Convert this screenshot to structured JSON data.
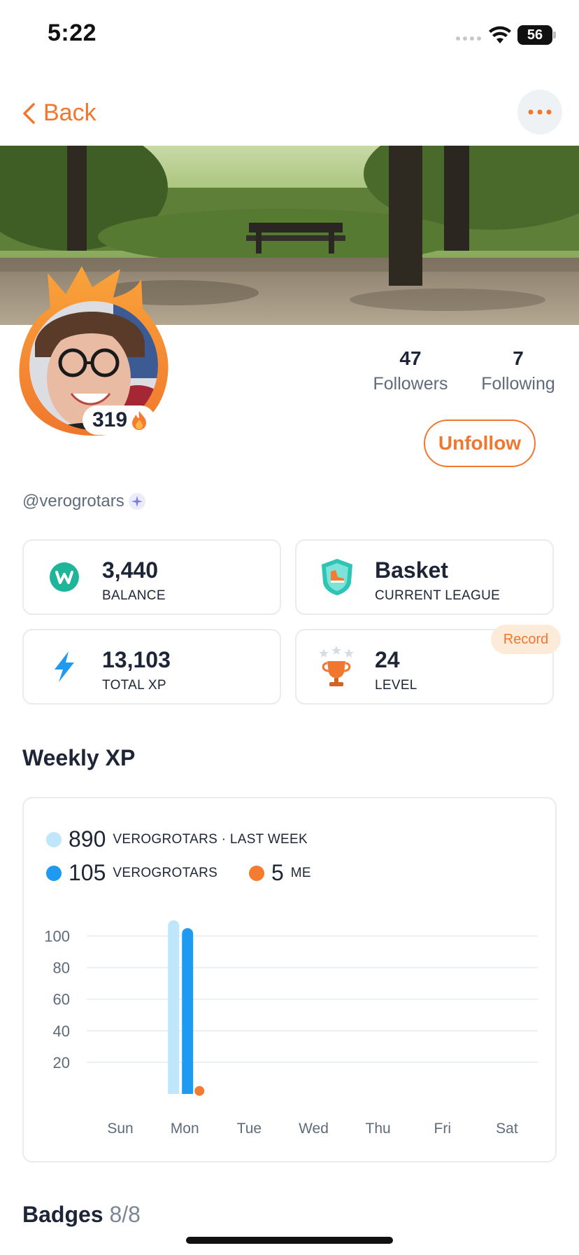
{
  "status": {
    "time": "5:22",
    "battery": "56"
  },
  "header": {
    "back_label": "Back"
  },
  "profile": {
    "streak": "319",
    "followers_count": "47",
    "followers_label": "Followers",
    "following_count": "7",
    "following_label": "Following",
    "unfollow_label": "Unfollow",
    "username": "@verogrotars"
  },
  "stats": {
    "balance_value": "3,440",
    "balance_label": "BALANCE",
    "league_value": "Basket",
    "league_label": "CURRENT LEAGUE",
    "xp_value": "13,103",
    "xp_label": "TOTAL XP",
    "level_value": "24",
    "level_label": "LEVEL",
    "record_label": "Record"
  },
  "weekly": {
    "title": "Weekly XP",
    "legend": [
      {
        "value": "890",
        "label": "VEROGROTARS · LAST WEEK",
        "color": "#bfe6fb"
      },
      {
        "value": "105",
        "label": "VEROGROTARS",
        "color": "#1e9bf0"
      },
      {
        "value": "5",
        "label": "ME",
        "color": "#f47b2f"
      }
    ]
  },
  "badges": {
    "title": "Badges",
    "count": "8/8"
  },
  "chart_data": {
    "type": "bar",
    "categories": [
      "Sun",
      "Mon",
      "Tue",
      "Wed",
      "Thu",
      "Fri",
      "Sat"
    ],
    "series": [
      {
        "name": "VEROGROTARS · LAST WEEK",
        "color": "#bfe6fb",
        "values": [
          0,
          110,
          0,
          0,
          0,
          0,
          0
        ]
      },
      {
        "name": "VEROGROTARS",
        "color": "#1e9bf0",
        "values": [
          0,
          105,
          0,
          0,
          0,
          0,
          0
        ]
      },
      {
        "name": "ME",
        "color": "#f47b2f",
        "values": [
          0,
          5,
          0,
          0,
          0,
          0,
          0
        ]
      }
    ],
    "yticks": [
      100,
      80,
      60,
      40,
      20
    ],
    "ylim": [
      0,
      110
    ],
    "grid": true
  }
}
